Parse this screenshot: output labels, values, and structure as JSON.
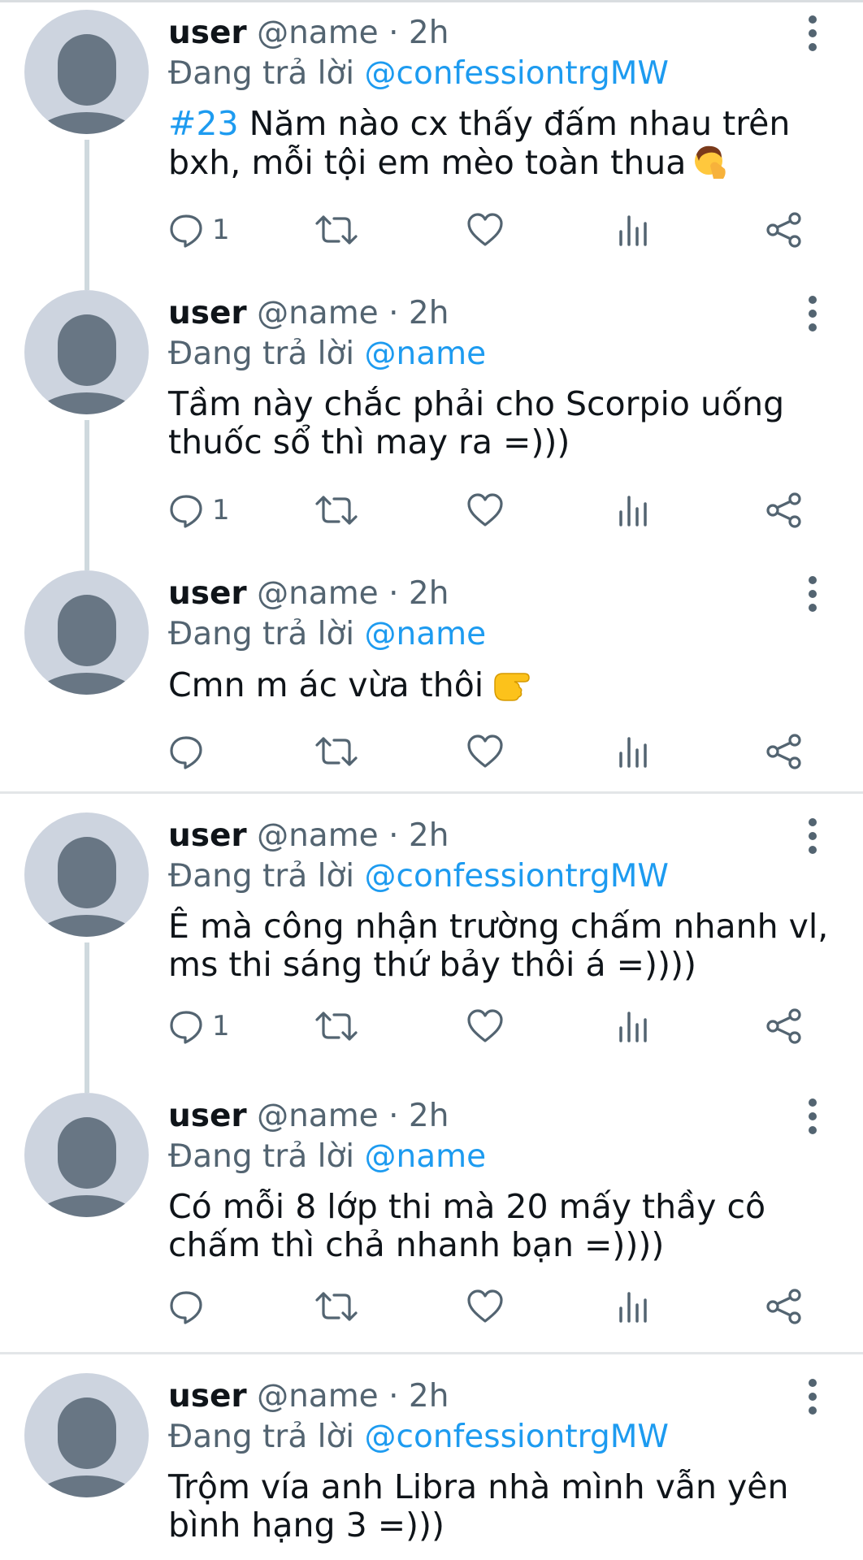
{
  "tweets": [
    {
      "user": "user",
      "handle": "@name",
      "dot": "·",
      "time": "2h",
      "reply_prefix": "Đang trả lời ",
      "reply_to": "@confessiontrgMW",
      "hashtag": "#23",
      "text": " Năm nào cx thấy đấm nhau trên bxh, mỗi tội em mèo toàn thua",
      "emoji_icon": "face-palm-icon",
      "reply_count": "1"
    },
    {
      "user": "user",
      "handle": "@name",
      "dot": "·",
      "time": "2h",
      "reply_prefix": "Đang trả lời ",
      "reply_to": "@name",
      "text": "Tầm này chắc phải cho Scorpio uống thuốc sổ thì may ra =)))",
      "reply_count": "1"
    },
    {
      "user": "user",
      "handle": "@name",
      "dot": "·",
      "time": "2h",
      "reply_prefix": "Đang trả lời ",
      "reply_to": "@name",
      "text": "Cmn m ác vừa thôi",
      "emoji_icon": "pointing-hand-icon",
      "reply_count": ""
    },
    {
      "user": "user",
      "handle": "@name",
      "dot": "·",
      "time": "2h",
      "reply_prefix": "Đang trả lời ",
      "reply_to": "@confessiontrgMW",
      "text": "Ê mà công nhận trường chấm nhanh vl, ms thi sáng thứ bảy thôi á =))))",
      "reply_count": "1"
    },
    {
      "user": "user",
      "handle": "@name",
      "dot": "·",
      "time": "2h",
      "reply_prefix": "Đang trả lời ",
      "reply_to": "@name",
      "text": "Có mỗi 8 lớp thi mà 20 mấy thầy cô chấm thì chả nhanh bạn =))))",
      "reply_count": ""
    },
    {
      "user": "user",
      "handle": "@name",
      "dot": "·",
      "time": "2h",
      "reply_prefix": "Đang trả lời ",
      "reply_to": "@confessiontrgMW",
      "text": "Trộm vía anh Libra nhà mình vẫn yên bình hạng 3 =)))",
      "reply_count": ""
    }
  ],
  "colors": {
    "link": "#1d9bf0",
    "muted": "#536471",
    "avatar_bg": "#cdd4df",
    "avatar_fg": "#687684"
  }
}
